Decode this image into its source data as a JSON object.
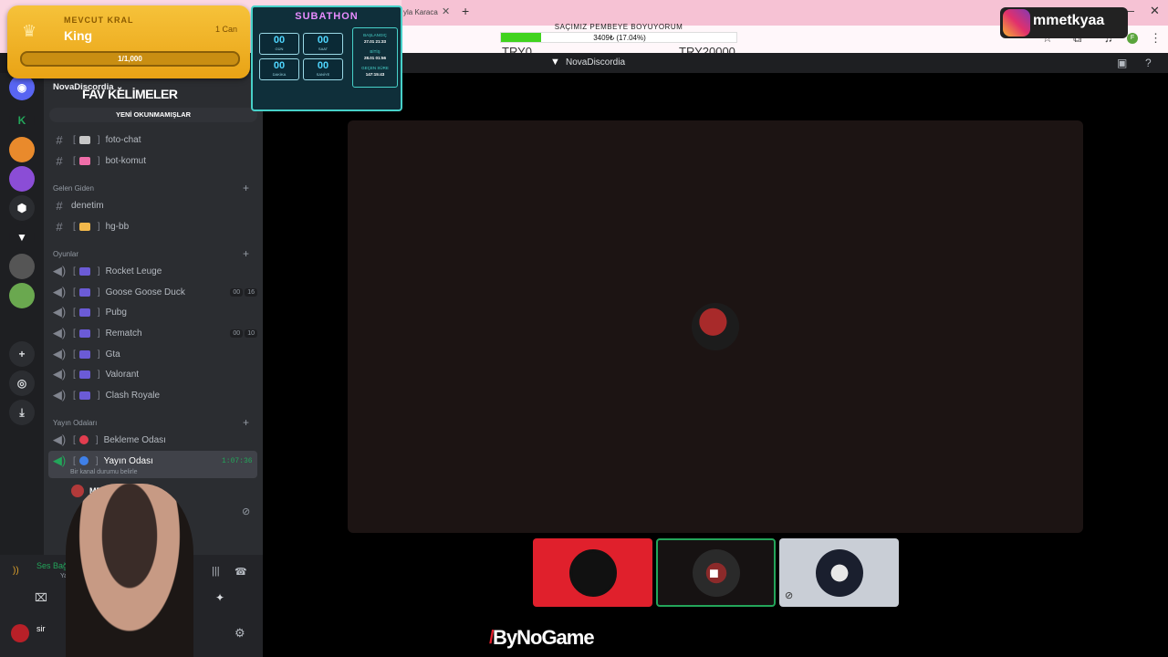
{
  "browser": {
    "tab_label": "yla Karaca",
    "new_tab": "+",
    "window_buttons": [
      "—",
      "✕"
    ]
  },
  "goal": {
    "title": "SAÇIMIZ PEMBEYE BOYUYORUM",
    "progress_text": "3409₺ (17.04%)",
    "progress": 0.1704,
    "left_mark": "TRY0",
    "right_mark": "TRY20000"
  },
  "discord": {
    "title": "NovaDiscordia",
    "server_name": "NovaDiscordia ⌄",
    "fav_overlay": "FAV KELİMELER",
    "unread_banner": "YENİ OKUNMAMIŞLAR",
    "channels_top": [
      {
        "name": "foto-chat",
        "emoji_color": "#c7c7c7"
      },
      {
        "name": "bot-komut",
        "emoji_color": "#f06ea9"
      }
    ],
    "cat_gelen": "Gelen Giden",
    "gelen_channels": [
      {
        "name": "denetim"
      },
      {
        "name": "hg-bb",
        "emoji_color": "#f2b84b"
      }
    ],
    "cat_oyunlar": "Oyunlar",
    "games": [
      {
        "name": "Rocket Leuge"
      },
      {
        "name": "Goose Goose Duck",
        "b1": "00",
        "b2": "16"
      },
      {
        "name": "Pubg"
      },
      {
        "name": "Rematch",
        "b1": "00",
        "b2": "10"
      },
      {
        "name": "Gta"
      },
      {
        "name": "Valorant"
      },
      {
        "name": "Clash Royale"
      }
    ],
    "cat_yayin": "Yayın Odaları",
    "yayin": [
      {
        "name": "Bekleme Odası",
        "dot": "#e23d4f"
      },
      {
        "name": "Yayın Odası",
        "dot": "#3f80e8"
      }
    ],
    "active_timer": "1:07:36",
    "status_hint": "Bir kanal durumu belirle",
    "member_name": "MEH",
    "voice_status": "Ses Bağla",
    "voice_channel": "Yayın Oda",
    "user_name": "sir"
  },
  "overlay": {
    "king_label": "MEVCUT KRAL",
    "king_name": "King",
    "king_count": "1 Can",
    "king_bar": "1/1,000",
    "subathon_title": "SUBATHON",
    "subathon_cells": [
      {
        "n": "00",
        "l": "GÜN"
      },
      {
        "n": "00",
        "l": "SAAT"
      },
      {
        "n": "00",
        "l": "DAKİKA"
      },
      {
        "n": "00",
        "l": "SANİYE"
      }
    ],
    "sub_start_label": "BAŞLANGIÇ",
    "sub_start": "27.01 21:33",
    "sub_end_label": "BİTİŞ",
    "sub_end": "28.01 01:56",
    "sub_elapsed_label": "GEÇEN SÜRE",
    "sub_elapsed": "147:15:43",
    "instagram": "mmetkyaa",
    "bynogame": "ByNoGame"
  },
  "colors": {
    "accent_green": "#23a55a",
    "stage_bg": "#1c1413",
    "tile_red": "#e0202c",
    "tile_grey": "#c9ced6"
  }
}
